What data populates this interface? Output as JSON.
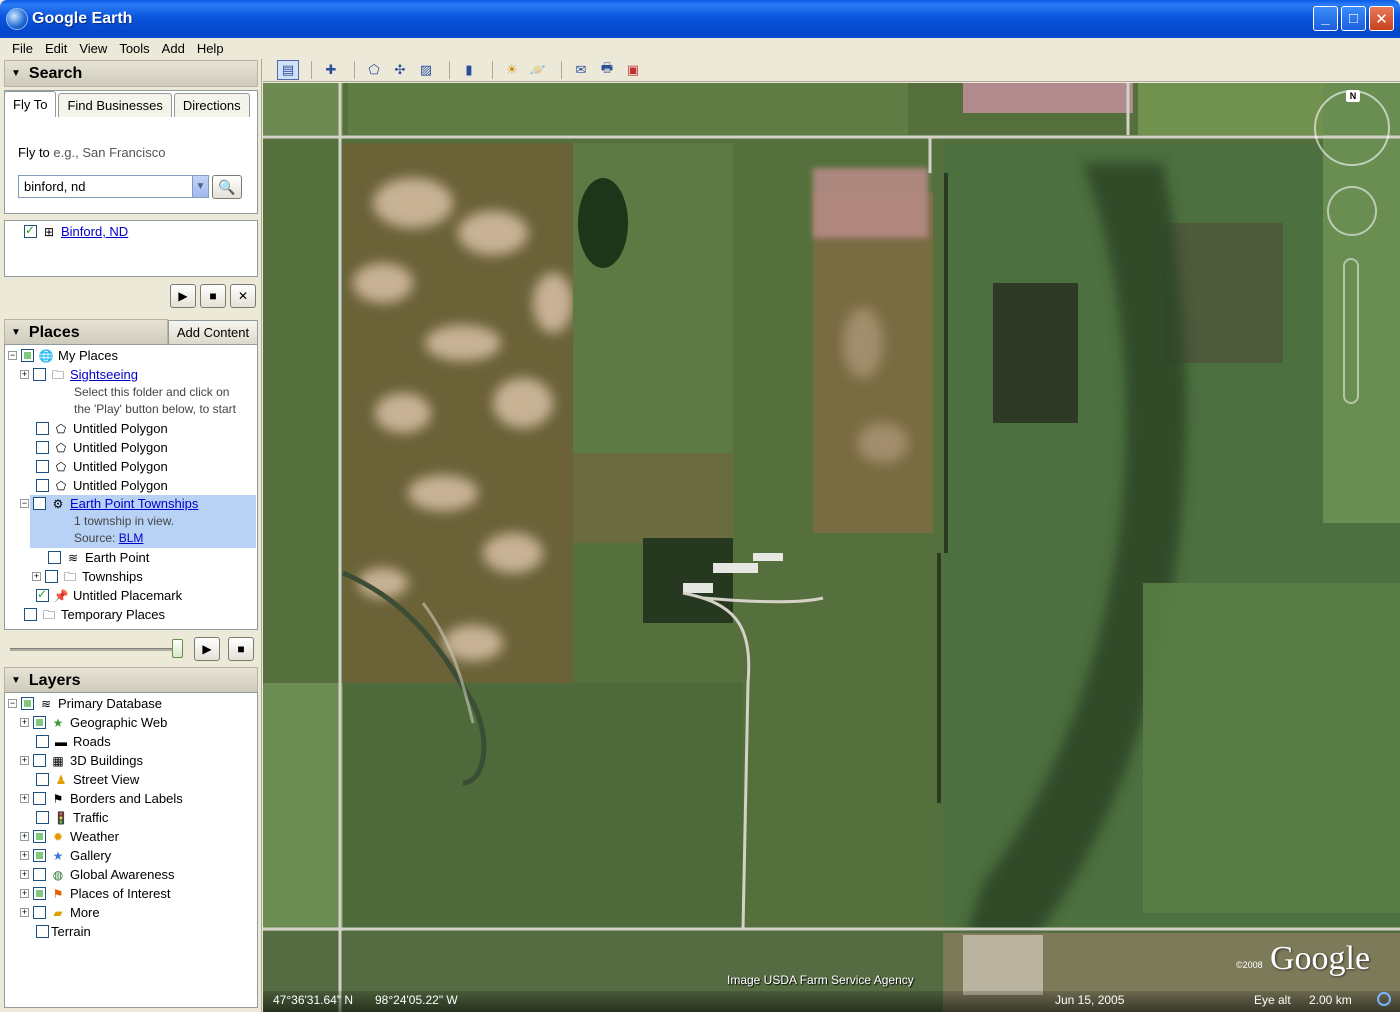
{
  "window": {
    "title": "Google Earth"
  },
  "menu": [
    "File",
    "Edit",
    "View",
    "Tools",
    "Add",
    "Help"
  ],
  "search": {
    "header": "Search",
    "tabs": [
      "Fly To",
      "Find Businesses",
      "Directions"
    ],
    "fly_label": "Fly to",
    "fly_placeholder": "e.g., San Francisco",
    "fly_value": "binford, nd",
    "result": "Binford, ND"
  },
  "places": {
    "header": "Places",
    "add_content": "Add Content",
    "my_places": "My Places",
    "sightseeing": "Sightseeing",
    "sightseeing_desc_1": "Select this folder and click on",
    "sightseeing_desc_2": "the 'Play' button below, to start",
    "polygons": [
      "Untitled Polygon",
      "Untitled Polygon",
      "Untitled Polygon",
      "Untitled Polygon"
    ],
    "earth_point_townships": "Earth Point Townships",
    "epts_desc": "1 township in view.",
    "epts_source_label": "Source:",
    "epts_source_link": "BLM",
    "earth_point": "Earth Point",
    "townships": "Townships",
    "untitled_placemark": "Untitled Placemark",
    "temporary_places": "Temporary Places"
  },
  "layers": {
    "header": "Layers",
    "items": [
      "Primary Database",
      "Geographic Web",
      "Roads",
      "3D Buildings",
      "Street View",
      "Borders and Labels",
      "Traffic",
      "Weather",
      "Gallery",
      "Global Awareness",
      "Places of Interest",
      "More",
      "Terrain"
    ]
  },
  "map": {
    "credit": "Image USDA Farm Service Agency",
    "logo": "Google",
    "logo_year": "©2008",
    "compass_n": "N",
    "lat": "47°36'31.64\" N",
    "lon": "98°24'05.22\" W",
    "date": "Jun 15, 2005",
    "eye_alt_label": "Eye alt",
    "eye_alt_value": "2.00 km"
  },
  "colors": {
    "title_bar": "#0a52d8",
    "selection": "#b8d2f5",
    "link": "#0000cc",
    "panel_bg": "#ece9d8"
  }
}
